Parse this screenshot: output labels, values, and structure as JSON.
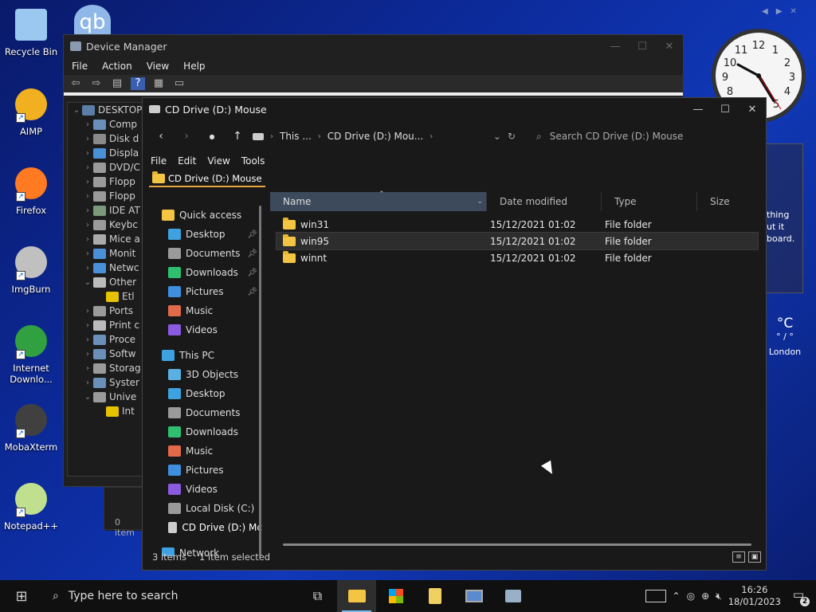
{
  "desktop": {
    "icons": [
      {
        "label": "Recycle Bin",
        "icon": "recycle-bin-icon"
      },
      {
        "label": "AIMP",
        "icon": "aimp-icon"
      },
      {
        "label": "Firefox",
        "icon": "firefox-icon"
      },
      {
        "label": "ImgBurn",
        "icon": "imgburn-icon"
      },
      {
        "label": "Internet Downlo...",
        "icon": "internet-download-manager-icon"
      },
      {
        "label": "MobaXterm",
        "icon": "mobaxterm-icon"
      },
      {
        "label": "Notepad++",
        "icon": "notepadpp-icon"
      }
    ],
    "qbittorrent_glyph": "qb"
  },
  "device_manager": {
    "title": "Device Manager",
    "menu": [
      "File",
      "Action",
      "View",
      "Help"
    ],
    "status": "0 item",
    "tree": [
      {
        "label": "DESKTOP",
        "chev": "⌄",
        "color": "#5a7ea6"
      },
      {
        "label": "Comp",
        "chev": "›",
        "color": "#6a8fb8"
      },
      {
        "label": "Disk d",
        "chev": "›",
        "color": "#8a8a8a"
      },
      {
        "label": "Displa",
        "chev": "›",
        "color": "#4a90d9"
      },
      {
        "label": "DVD/C",
        "chev": "›",
        "color": "#9a9a9a"
      },
      {
        "label": "Flopp",
        "chev": "›",
        "color": "#9a9a9a"
      },
      {
        "label": "Flopp",
        "chev": "›",
        "color": "#9a9a9a"
      },
      {
        "label": "IDE AT",
        "chev": "›",
        "color": "#7a9a7a"
      },
      {
        "label": "Keybc",
        "chev": "›",
        "color": "#9a9a9a"
      },
      {
        "label": "Mice a",
        "chev": "›",
        "color": "#aaaaaa"
      },
      {
        "label": "Monit",
        "chev": "›",
        "color": "#4a90d9"
      },
      {
        "label": "Netwc",
        "chev": "›",
        "color": "#4a90d9"
      },
      {
        "label": "Other",
        "chev": "⌄",
        "color": "#bbbbbb"
      },
      {
        "label": "Etl",
        "chev": "",
        "color": "#e6c200"
      },
      {
        "label": "Ports",
        "chev": "›",
        "color": "#9a9a9a"
      },
      {
        "label": "Print c",
        "chev": "›",
        "color": "#bbbbbb"
      },
      {
        "label": "Proce",
        "chev": "›",
        "color": "#6a8fb8"
      },
      {
        "label": "Softw",
        "chev": "›",
        "color": "#6a8fb8"
      },
      {
        "label": "Storag",
        "chev": "›",
        "color": "#9a9a9a"
      },
      {
        "label": "Syster",
        "chev": "›",
        "color": "#6a8fb8"
      },
      {
        "label": "Unive",
        "chev": "⌄",
        "color": "#9a9a9a"
      },
      {
        "label": "Int",
        "chev": "",
        "color": "#e6c200"
      }
    ]
  },
  "explorer": {
    "title": "CD Drive (D:) Mouse",
    "address": {
      "crumbs": [
        "This ...",
        "CD Drive (D:) Mou..."
      ]
    },
    "search_placeholder": "Search CD Drive (D:) Mouse",
    "menu": [
      "File",
      "Edit",
      "View",
      "Tools"
    ],
    "tab_label": "CD Drive (D:) Mouse",
    "columns": {
      "name": "Name",
      "date": "Date modified",
      "type": "Type",
      "size": "Size"
    },
    "nav": [
      {
        "label": "Quick access",
        "color": "#f4c542",
        "pinned": false,
        "indent": 0
      },
      {
        "label": "Desktop",
        "color": "#3fa2e0",
        "pinned": true,
        "indent": 1
      },
      {
        "label": "Documents",
        "color": "#9a9a9a",
        "pinned": true,
        "indent": 1
      },
      {
        "label": "Downloads",
        "color": "#2fbf71",
        "pinned": true,
        "indent": 1
      },
      {
        "label": "Pictures",
        "color": "#3f8fe0",
        "pinned": true,
        "indent": 1
      },
      {
        "label": "Music",
        "color": "#e06a4a",
        "pinned": false,
        "indent": 1
      },
      {
        "label": "Videos",
        "color": "#8a5ae0",
        "pinned": false,
        "indent": 1
      },
      {
        "label": "This PC",
        "color": "#3fa2e0",
        "pinned": false,
        "indent": 0
      },
      {
        "label": "3D Objects",
        "color": "#5ab0e0",
        "pinned": false,
        "indent": 1
      },
      {
        "label": "Desktop",
        "color": "#3fa2e0",
        "pinned": false,
        "indent": 1
      },
      {
        "label": "Documents",
        "color": "#9a9a9a",
        "pinned": false,
        "indent": 1
      },
      {
        "label": "Downloads",
        "color": "#2fbf71",
        "pinned": false,
        "indent": 1
      },
      {
        "label": "Music",
        "color": "#e06a4a",
        "pinned": false,
        "indent": 1
      },
      {
        "label": "Pictures",
        "color": "#3f8fe0",
        "pinned": false,
        "indent": 1
      },
      {
        "label": "Videos",
        "color": "#8a5ae0",
        "pinned": false,
        "indent": 1
      },
      {
        "label": "Local Disk (C:)",
        "color": "#9a9a9a",
        "pinned": false,
        "indent": 1
      },
      {
        "label": "CD Drive (D:) Mc",
        "color": "#cccccc",
        "pinned": false,
        "indent": 1,
        "selected": true
      },
      {
        "label": "Network",
        "color": "#3fa2e0",
        "pinned": false,
        "indent": 0
      }
    ],
    "files": [
      {
        "name": "win31",
        "date": "15/12/2021 01:02",
        "type": "File folder",
        "selected": false
      },
      {
        "name": "win95",
        "date": "15/12/2021 01:02",
        "type": "File folder",
        "selected": true
      },
      {
        "name": "winnt",
        "date": "15/12/2021 01:02",
        "type": "File folder",
        "selected": false
      }
    ],
    "status": {
      "count": "3 items",
      "selection": "1 item selected"
    }
  },
  "widgets": {
    "gadget_text": [
      "thing",
      "ut it",
      "board."
    ],
    "weather": {
      "temp": "°C",
      "range": "° / °",
      "city": "London"
    }
  },
  "taskbar": {
    "search_placeholder": "Type here to search",
    "time": "16:26",
    "date": "18/01/2023",
    "notifications": "2"
  }
}
